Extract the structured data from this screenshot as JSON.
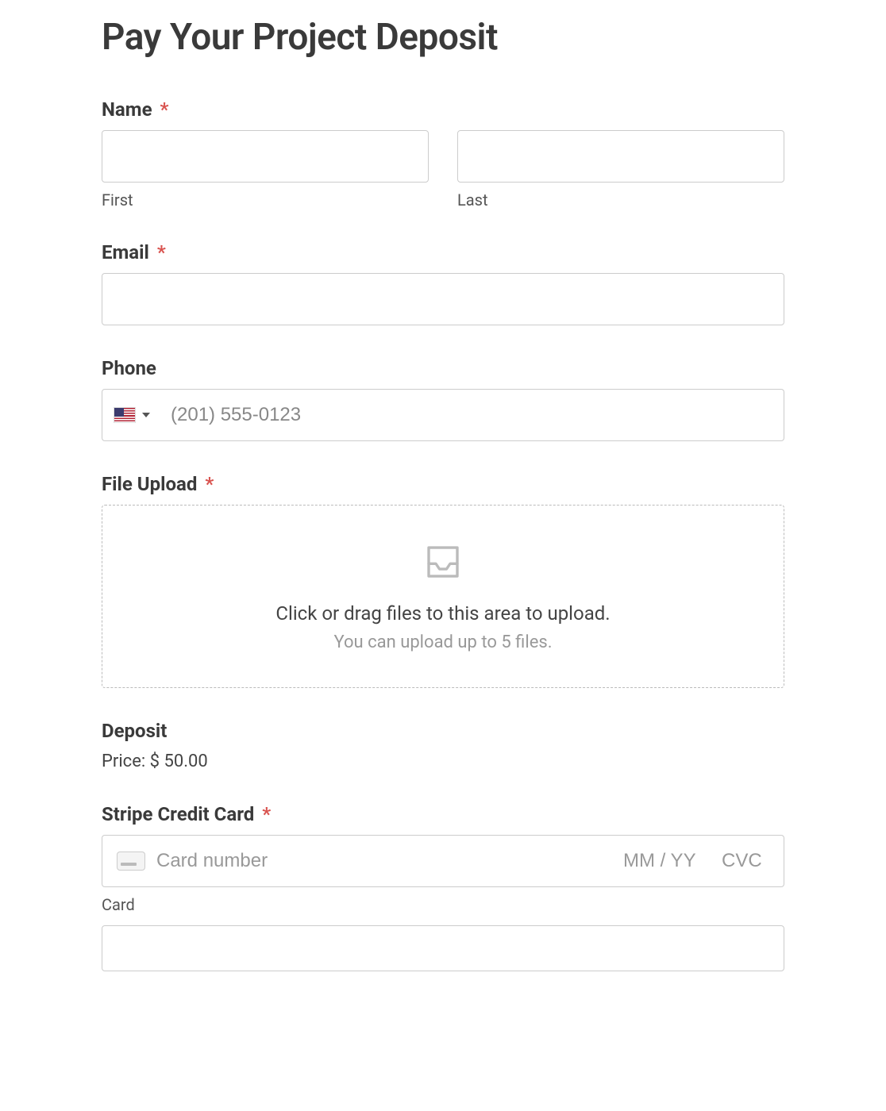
{
  "page": {
    "title": "Pay Your Project Deposit"
  },
  "name": {
    "label": "Name",
    "required": "*",
    "first_sub": "First",
    "last_sub": "Last"
  },
  "email": {
    "label": "Email",
    "required": "*"
  },
  "phone": {
    "label": "Phone",
    "placeholder": "(201) 555-0123"
  },
  "file_upload": {
    "label": "File Upload",
    "required": "*",
    "drop_title": "Click or drag files to this area to upload.",
    "drop_sub": "You can upload up to 5 files."
  },
  "deposit": {
    "label": "Deposit",
    "price_text": "Price: $ 50.00"
  },
  "stripe": {
    "label": "Stripe Credit Card",
    "required": "*",
    "card_number_placeholder": "Card number",
    "exp_placeholder": "MM / YY",
    "cvc_placeholder": "CVC",
    "card_sub": "Card"
  }
}
